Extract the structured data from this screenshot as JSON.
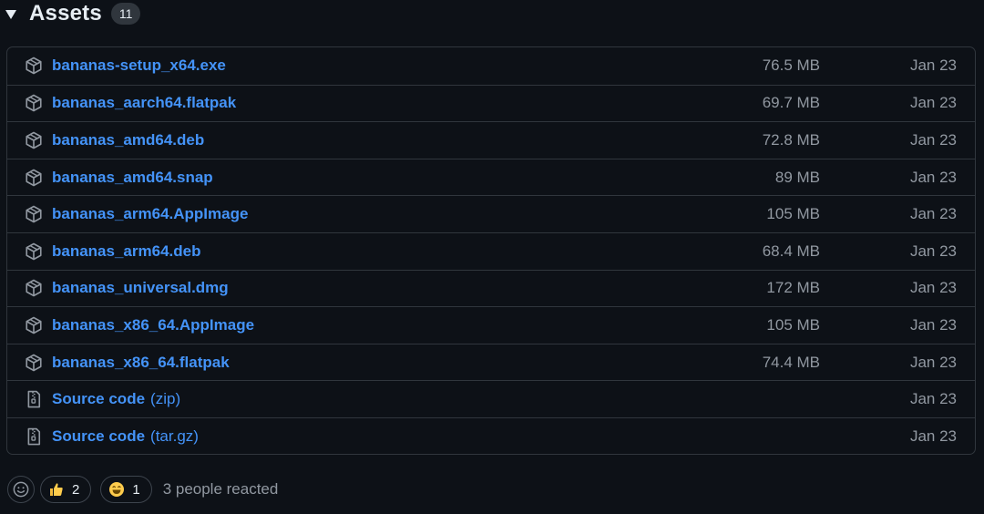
{
  "header": {
    "title": "Assets",
    "count": "11"
  },
  "assets": [
    {
      "name": "bananas-setup_x64.exe",
      "suffix": "",
      "size": "76.5 MB",
      "date": "Jan 23",
      "icon": "package-icon"
    },
    {
      "name": "bananas_aarch64.flatpak",
      "suffix": "",
      "size": "69.7 MB",
      "date": "Jan 23",
      "icon": "package-icon"
    },
    {
      "name": "bananas_amd64.deb",
      "suffix": "",
      "size": "72.8 MB",
      "date": "Jan 23",
      "icon": "package-icon"
    },
    {
      "name": "bananas_amd64.snap",
      "suffix": "",
      "size": "89 MB",
      "date": "Jan 23",
      "icon": "package-icon"
    },
    {
      "name": "bananas_arm64.AppImage",
      "suffix": "",
      "size": "105 MB",
      "date": "Jan 23",
      "icon": "package-icon"
    },
    {
      "name": "bananas_arm64.deb",
      "suffix": "",
      "size": "68.4 MB",
      "date": "Jan 23",
      "icon": "package-icon"
    },
    {
      "name": "bananas_universal.dmg",
      "suffix": "",
      "size": "172 MB",
      "date": "Jan 23",
      "icon": "package-icon"
    },
    {
      "name": "bananas_x86_64.AppImage",
      "suffix": "",
      "size": "105 MB",
      "date": "Jan 23",
      "icon": "package-icon"
    },
    {
      "name": "bananas_x86_64.flatpak",
      "suffix": "",
      "size": "74.4 MB",
      "date": "Jan 23",
      "icon": "package-icon"
    },
    {
      "name": "Source code",
      "suffix": "(zip)",
      "size": "",
      "date": "Jan 23",
      "icon": "file-zip-icon"
    },
    {
      "name": "Source code",
      "suffix": "(tar.gz)",
      "size": "",
      "date": "Jan 23",
      "icon": "file-zip-icon"
    }
  ],
  "reactions": {
    "items": [
      {
        "emoji": "thumbs-up-icon",
        "count": "2"
      },
      {
        "emoji": "laughing-face-icon",
        "count": "1"
      }
    ],
    "summary": "3 people reacted"
  },
  "colors": {
    "background": "#0d1117",
    "border": "#30363d",
    "link": "#4493f8",
    "muted": "#9198a1",
    "text": "#e6edf3"
  }
}
